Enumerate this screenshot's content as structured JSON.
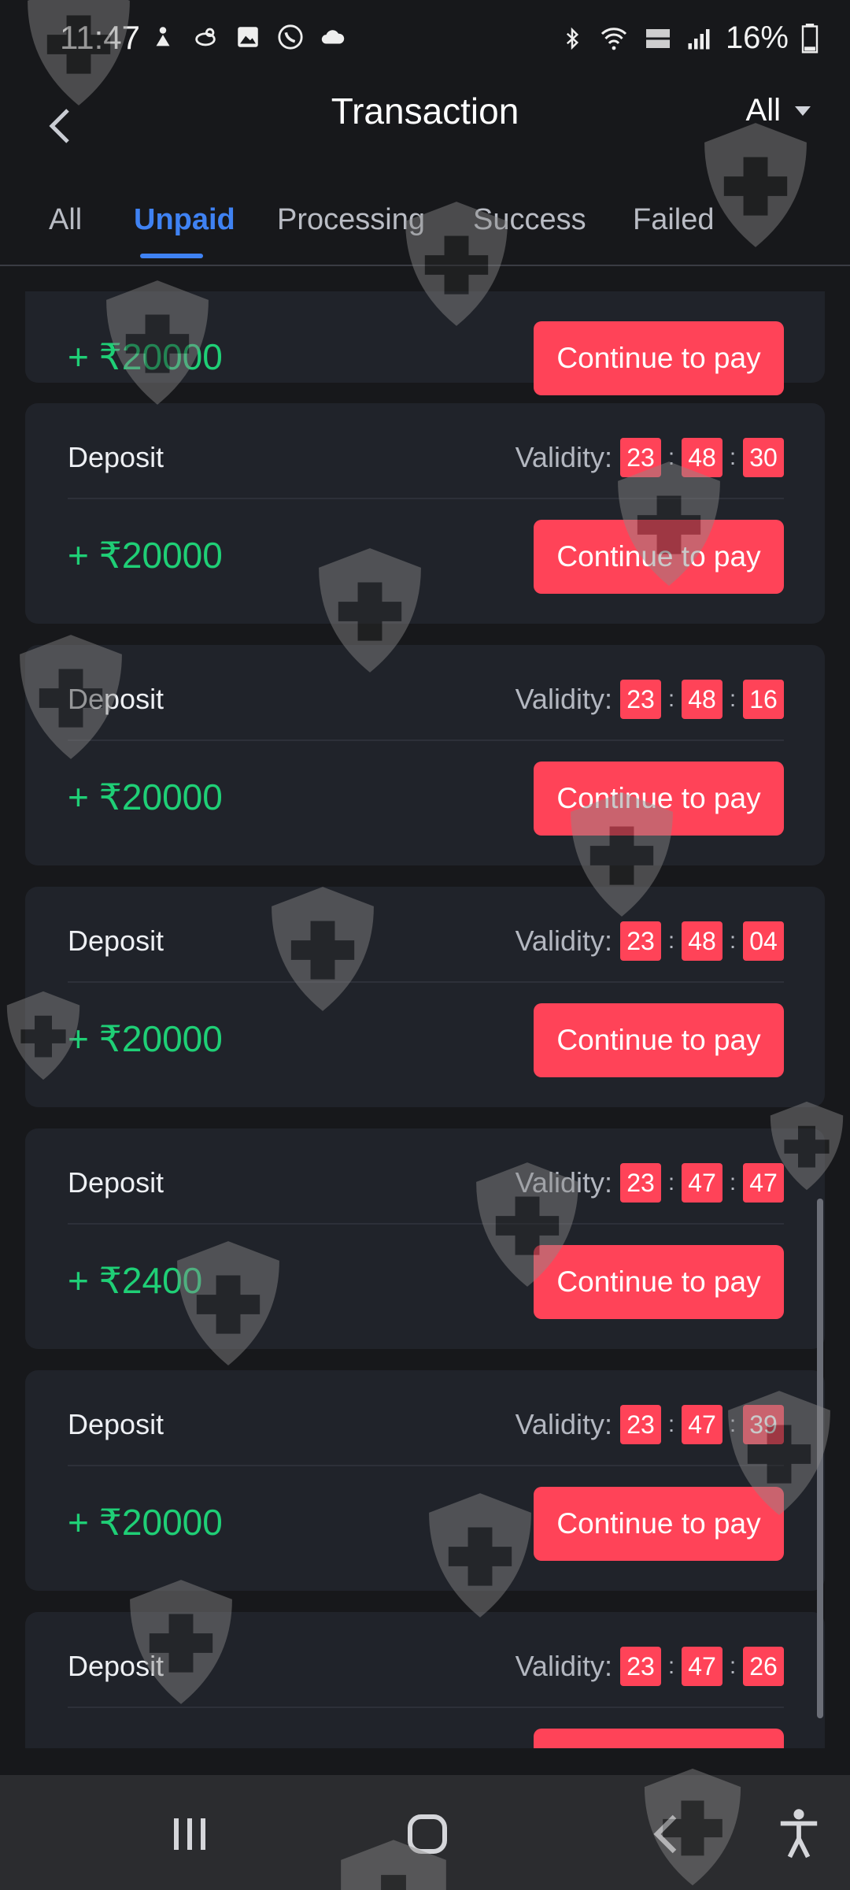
{
  "status_bar": {
    "time": "11:47",
    "battery": "16%",
    "left_icons": [
      "person-icon",
      "bird-icon",
      "image-icon",
      "call-icon",
      "cloud-icon"
    ],
    "right_icons": [
      "bluetooth-icon",
      "wifi-icon",
      "vowifi-icon",
      "signal-icon",
      "battery-icon"
    ]
  },
  "header": {
    "title": "Transaction",
    "filter_label": "All"
  },
  "tabs": [
    {
      "label": "All",
      "active": false
    },
    {
      "label": "Unpaid",
      "active": true
    },
    {
      "label": "Processing",
      "active": false
    },
    {
      "label": "Success",
      "active": false
    },
    {
      "label": "Failed",
      "active": false
    }
  ],
  "validity_label": "Validity",
  "pay_label": "Continue to pay",
  "transactions": [
    {
      "type": "Deposit",
      "amount": "+ ₹20000",
      "validity": [
        "",
        "",
        ""
      ]
    },
    {
      "type": "Deposit",
      "amount": "+ ₹20000",
      "validity": [
        "23",
        "48",
        "30"
      ]
    },
    {
      "type": "Deposit",
      "amount": "+ ₹20000",
      "validity": [
        "23",
        "48",
        "16"
      ]
    },
    {
      "type": "Deposit",
      "amount": "+ ₹20000",
      "validity": [
        "23",
        "48",
        "04"
      ]
    },
    {
      "type": "Deposit",
      "amount": "+ ₹2400",
      "validity": [
        "23",
        "47",
        "47"
      ]
    },
    {
      "type": "Deposit",
      "amount": "+ ₹20000",
      "validity": [
        "23",
        "47",
        "39"
      ]
    },
    {
      "type": "Deposit",
      "amount": "",
      "validity": [
        "23",
        "47",
        "26"
      ]
    }
  ],
  "colors": {
    "background": "#17181b",
    "card": "#20232a",
    "accent_tab": "#3f82f3",
    "pay_button": "#ff4358",
    "amount": "#1fcf76"
  },
  "navbar": {
    "icons": [
      "recent-apps-icon",
      "home-icon",
      "back-icon",
      "accessibility-icon"
    ]
  }
}
